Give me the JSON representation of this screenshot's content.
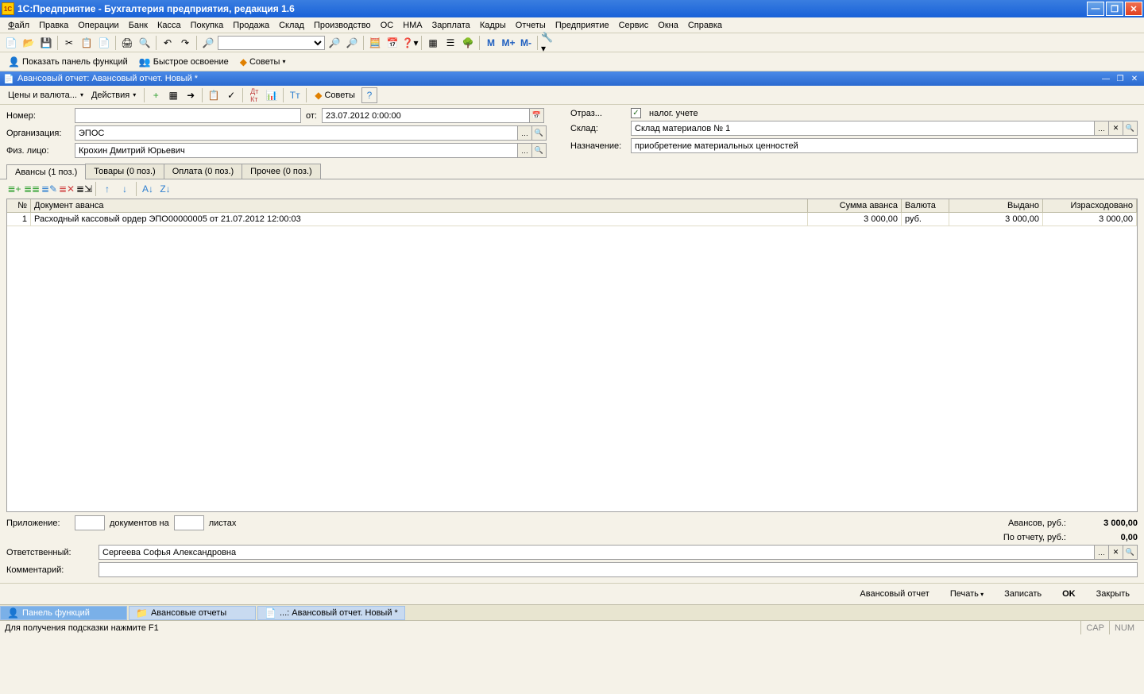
{
  "title": "1С:Предприятие - Бухгалтерия предприятия, редакция 1.6",
  "menu": [
    "Файл",
    "Правка",
    "Операции",
    "Банк",
    "Касса",
    "Покупка",
    "Продажа",
    "Склад",
    "Производство",
    "ОС",
    "НМА",
    "Зарплата",
    "Кадры",
    "Отчеты",
    "Предприятие",
    "Сервис",
    "Окна",
    "Справка"
  ],
  "toolbar2": {
    "show_panel": "Показать панель функций",
    "quick_start": "Быстрое освоение",
    "tips": "Советы"
  },
  "subwin_title": "Авансовый отчет: Авансовый отчет. Новый *",
  "doc_toolbar": {
    "prices": "Цены и валюта...",
    "actions": "Действия",
    "tips": "Советы"
  },
  "form": {
    "number_label": "Номер:",
    "number": "",
    "date_label": "от:",
    "date": "23.07.2012  0:00:00",
    "org_label": "Организация:",
    "org": "ЭПОС",
    "person_label": "Физ. лицо:",
    "person": "Крохин Дмитрий Юрьевич",
    "reflect_label": "Отраз...",
    "tax_check": "налог. учете",
    "warehouse_label": "Склад:",
    "warehouse": "Склад материалов № 1",
    "purpose_label": "Назначение:",
    "purpose": "приобретение материальных ценностей"
  },
  "tabs": [
    "Авансы (1 поз.)",
    "Товары (0 поз.)",
    "Оплата (0 поз.)",
    "Прочее (0 поз.)"
  ],
  "grid": {
    "headers": {
      "num": "№",
      "doc": "Документ аванса",
      "sum": "Сумма аванса",
      "cur": "Валюта",
      "issued": "Выдано",
      "spent": "Израсходовано"
    },
    "rows": [
      {
        "num": "1",
        "doc": "Расходный кассовый ордер ЭПО00000005 от 21.07.2012 12:00:03",
        "sum": "3 000,00",
        "cur": "руб.",
        "issued": "3 000,00",
        "spent": "3 000,00"
      }
    ]
  },
  "bottom": {
    "attach_label": "Приложение:",
    "docs_text": "документов на",
    "sheets_text": "листах",
    "advances_label": "Авансов, руб.:",
    "advances_val": "3 000,00",
    "report_label": "По отчету, руб.:",
    "report_val": "0,00",
    "resp_label": "Ответственный:",
    "resp": "Сергеева Софья Александровна",
    "comment_label": "Комментарий:",
    "comment": ""
  },
  "footer": {
    "report_btn": "Авансовый отчет",
    "print_btn": "Печать",
    "write_btn": "Записать",
    "ok_btn": "OK",
    "close_btn": "Закрыть"
  },
  "taskbar": [
    "Панель функций",
    "Авансовые отчеты",
    "...: Авансовый отчет. Новый *"
  ],
  "statusbar": {
    "hint": "Для получения подсказки нажмите F1",
    "cap": "CAP",
    "num": "NUM"
  }
}
